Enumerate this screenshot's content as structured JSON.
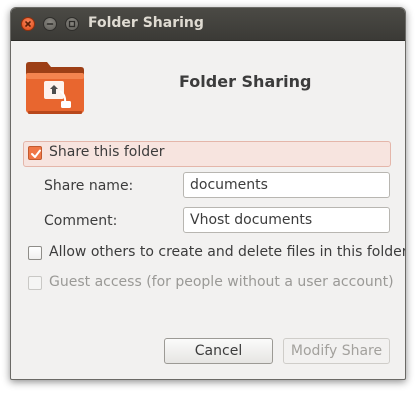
{
  "window": {
    "title": "Folder Sharing"
  },
  "header": {
    "heading": "Folder Sharing",
    "icon": "folder-share-icon"
  },
  "share_folder": {
    "label": "Share this folder",
    "checked": true
  },
  "share_name": {
    "label": "Share name:",
    "value": "documents"
  },
  "comment": {
    "label": "Comment:",
    "value": "Vhost documents"
  },
  "allow_others": {
    "label": "Allow others to create and delete files in this folder",
    "checked": false
  },
  "guest_access": {
    "label": "Guest access (for people without a user account)",
    "checked": false,
    "enabled": false
  },
  "buttons": {
    "cancel": "Cancel",
    "modify": "Modify Share"
  },
  "colors": {
    "accent": "#f07746",
    "titlebar": "#3c3b37",
    "highlight": "#f7e4df"
  }
}
